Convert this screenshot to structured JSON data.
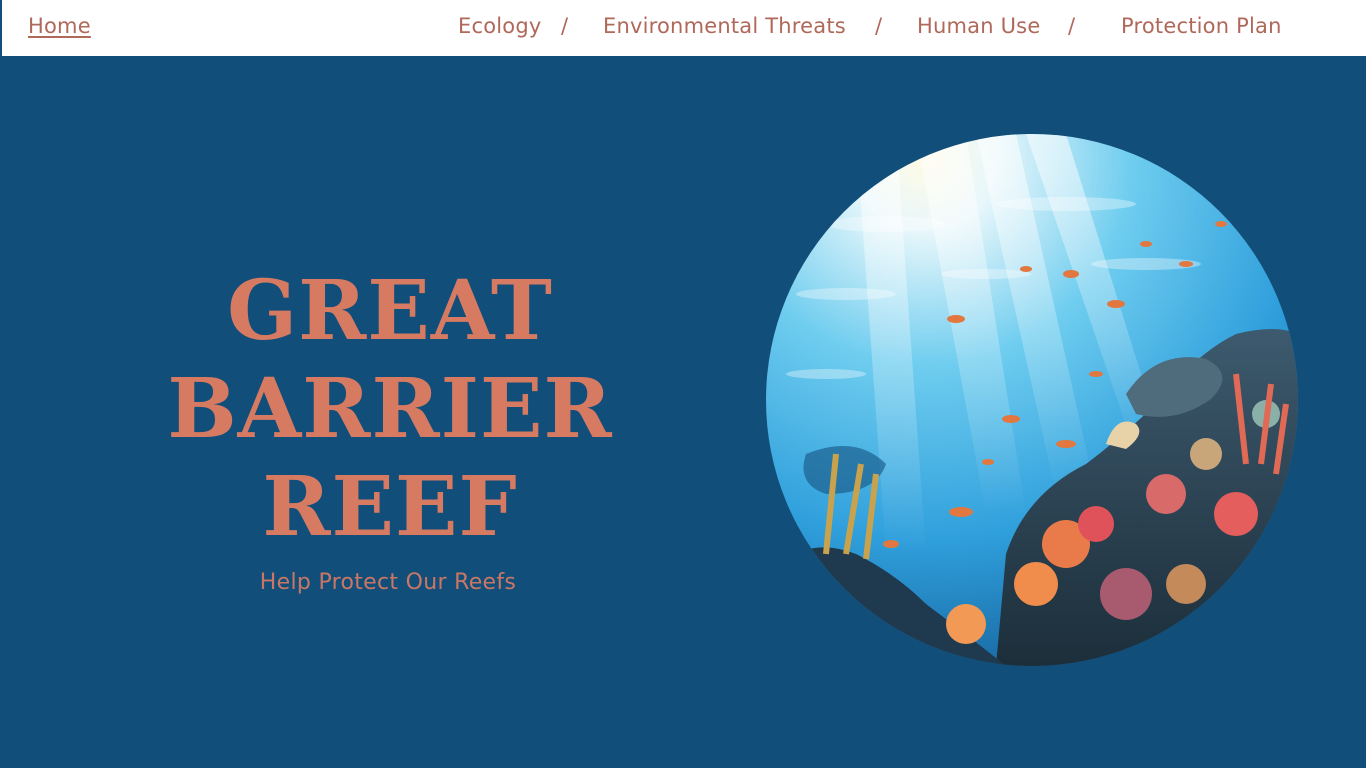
{
  "nav": {
    "home": "Home",
    "items": [
      "Ecology",
      "Environmental Threats",
      "Human Use",
      "Protection Plan"
    ],
    "separator": "/"
  },
  "hero": {
    "title_lines": [
      "GREAT",
      "BARRIER",
      "REEF"
    ],
    "subtitle": "Help Protect Our Reefs"
  },
  "image": {
    "subject": "underwater-coral-reef-illustration"
  },
  "colors": {
    "background": "#124e7a",
    "accent": "#d77a62",
    "nav_text": "#b0685a",
    "nav_bg": "#ffffff"
  }
}
